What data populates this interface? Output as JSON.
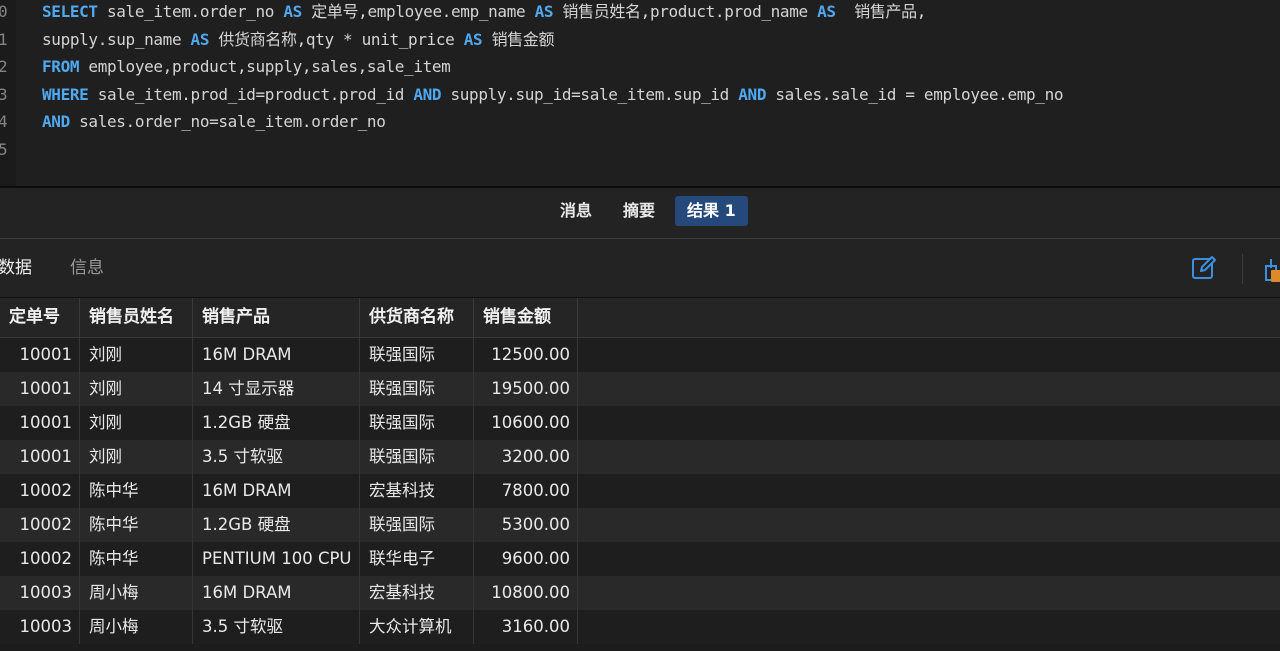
{
  "editor": {
    "lines": [
      {
        "num": "0",
        "tokens": [
          {
            "t": "SELECT",
            "k": true
          },
          {
            "t": " sale_item.order_no ",
            "k": false
          },
          {
            "t": "AS",
            "k": true
          },
          {
            "t": " 定单号,employee.emp_name ",
            "k": false
          },
          {
            "t": "AS",
            "k": true
          },
          {
            "t": " 销售员姓名,product.prod_name ",
            "k": false
          },
          {
            "t": "AS",
            "k": true
          },
          {
            "t": "  销售产品,",
            "k": false
          }
        ]
      },
      {
        "num": "1",
        "tokens": [
          {
            "t": "supply.sup_name ",
            "k": false
          },
          {
            "t": "AS",
            "k": true
          },
          {
            "t": " 供货商名称,qty * unit_price ",
            "k": false
          },
          {
            "t": "AS",
            "k": true
          },
          {
            "t": " 销售金额",
            "k": false
          }
        ]
      },
      {
        "num": "2",
        "tokens": [
          {
            "t": "FROM",
            "k": true
          },
          {
            "t": " employee,product,supply,sales,sale_item",
            "k": false
          }
        ]
      },
      {
        "num": "3",
        "tokens": [
          {
            "t": "WHERE",
            "k": true
          },
          {
            "t": " sale_item.prod_id=product.prod_id ",
            "k": false
          },
          {
            "t": "AND",
            "k": true
          },
          {
            "t": " supply.sup_id=sale_item.sup_id ",
            "k": false
          },
          {
            "t": "AND",
            "k": true
          },
          {
            "t": " sales.sale_id = employee.emp_no",
            "k": false
          }
        ]
      },
      {
        "num": "4",
        "tokens": [
          {
            "t": "AND",
            "k": true
          },
          {
            "t": " sales.order_no=sale_item.order_no",
            "k": false
          }
        ]
      },
      {
        "num": "5",
        "tokens": []
      }
    ]
  },
  "result_tabs": {
    "messages": "消息",
    "summary": "摘要",
    "result1": "结果 1"
  },
  "subtabs": {
    "data": "数据",
    "info": "信息"
  },
  "toolbar_icons": [
    "edit-icon",
    "export-icon"
  ],
  "grid": {
    "columns": [
      "定单号",
      "销售员姓名",
      "销售产品",
      "供货商名称",
      "销售金额"
    ],
    "rows": [
      [
        "10001",
        "刘刚",
        "16M DRAM",
        "联强国际",
        "12500.00"
      ],
      [
        "10001",
        "刘刚",
        "14 寸显示器",
        "联强国际",
        "19500.00"
      ],
      [
        "10001",
        "刘刚",
        "1.2GB 硬盘",
        "联强国际",
        "10600.00"
      ],
      [
        "10001",
        "刘刚",
        "3.5 寸软驱",
        "联强国际",
        "3200.00"
      ],
      [
        "10002",
        "陈中华",
        "16M DRAM",
        "宏基科技",
        "7800.00"
      ],
      [
        "10002",
        "陈中华",
        "1.2GB 硬盘",
        "联强国际",
        "5300.00"
      ],
      [
        "10002",
        "陈中华",
        "PENTIUM 100 CPU",
        "联华电子",
        "9600.00"
      ],
      [
        "10003",
        "周小梅",
        "16M DRAM",
        "宏基科技",
        "10800.00"
      ],
      [
        "10003",
        "周小梅",
        "3.5 寸软驱",
        "大众计算机",
        "3160.00"
      ]
    ]
  },
  "colors": {
    "keyword": "#4fa8f0",
    "active_tab": "#24497a",
    "icon_blue": "#3d8fe0",
    "icon_orange": "#e0892a"
  }
}
